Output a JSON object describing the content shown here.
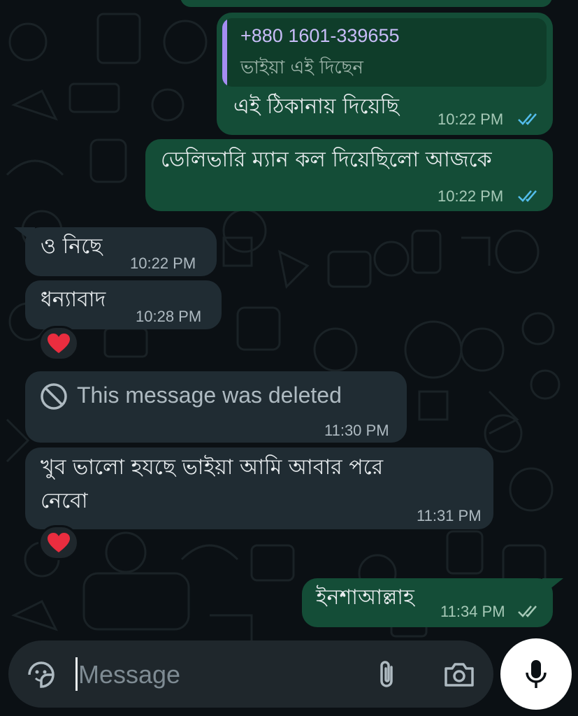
{
  "messages": [
    {
      "id": "m1",
      "direction": "outgoing",
      "quote": {
        "sender": "+880 1601-339655",
        "text": "ভাইয়া এই দিছেন"
      },
      "text": "এই ঠিকানায় দিয়েছি",
      "time": "10:22 PM",
      "status": "read"
    },
    {
      "id": "m2",
      "direction": "outgoing",
      "text": "ডেলিভারি ম্যান কল দিয়েছিলো আজকে",
      "time": "10:22 PM",
      "status": "read"
    },
    {
      "id": "m3",
      "direction": "incoming",
      "text": "ও নিছে",
      "time": "10:22 PM"
    },
    {
      "id": "m4",
      "direction": "incoming",
      "text": "ধন্যাবাদ",
      "time": "10:28 PM",
      "reaction": "❤️"
    },
    {
      "id": "m5",
      "direction": "incoming",
      "deleted": true,
      "text": "This message was deleted",
      "time": "11:30 PM"
    },
    {
      "id": "m6",
      "direction": "incoming",
      "text_line1": "খুব ভালো হযছে ভাইয়া আমি আবার পরে",
      "text_line2": "নেবো",
      "time": "11:31 PM",
      "reaction": "❤️"
    },
    {
      "id": "m7",
      "direction": "outgoing",
      "text": "ইনশাআল্লাহ",
      "time": "11:34 PM",
      "status": "delivered"
    }
  ],
  "composer": {
    "placeholder": "Message"
  },
  "colors": {
    "outgoing_bubble": "#144d37",
    "incoming_bubble": "#202c33",
    "read_ticks": "#53bdeb",
    "background": "#0b1014"
  }
}
